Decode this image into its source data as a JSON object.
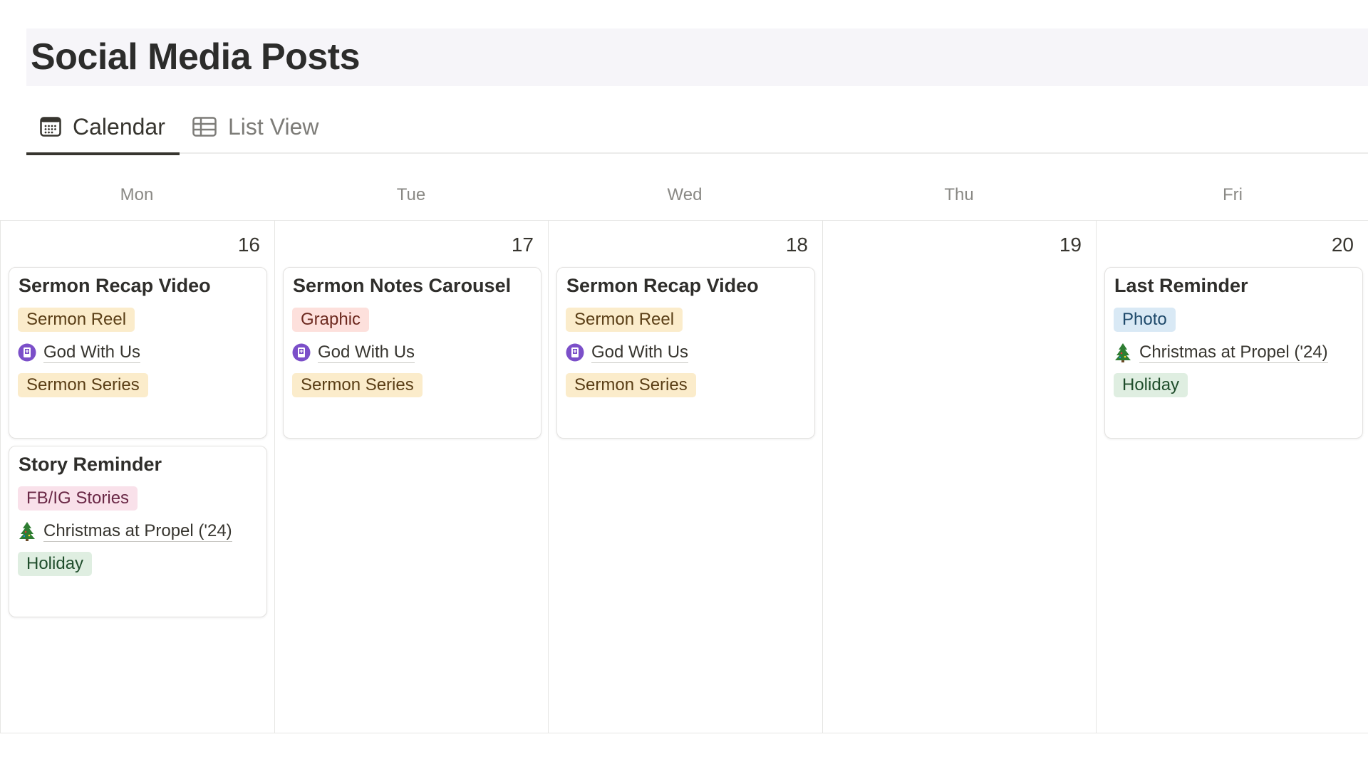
{
  "page": {
    "title": "Social Media Posts"
  },
  "tabs": [
    {
      "label": "Calendar",
      "icon": "calendar-icon",
      "active": true
    },
    {
      "label": "List View",
      "icon": "table-icon",
      "active": false
    }
  ],
  "weekdays": [
    "Mon",
    "Tue",
    "Wed",
    "Thu",
    "Fri"
  ],
  "dates": [
    "16",
    "17",
    "18",
    "19",
    "20"
  ],
  "colors": {
    "yellow_tag": "#fbeccb",
    "red_tag": "#fde0dc",
    "pink_tag": "#f9e1ea",
    "blue_tag": "#d9e9f5",
    "green_tag": "#dfeee1",
    "series_icon": "#7b4fc9"
  },
  "cards": {
    "mon_1": {
      "title": "Sermon Recap Video",
      "type": "Sermon Reel",
      "relation": "God With Us",
      "relation_icon": "book-icon",
      "category": "Sermon Series"
    },
    "mon_2": {
      "title": "Story Reminder",
      "type": "FB/IG Stories",
      "relation": "Christmas at Propel ('24)",
      "relation_icon": "christmas-tree-icon",
      "category": "Holiday"
    },
    "tue_1": {
      "title": "Sermon Notes Carousel",
      "type": "Graphic",
      "relation": "God With Us",
      "relation_icon": "book-icon",
      "category": "Sermon Series"
    },
    "wed_1": {
      "title": "Sermon Recap Video",
      "type": "Sermon Reel",
      "relation": "God With Us",
      "relation_icon": "book-icon",
      "category": "Sermon Series"
    },
    "fri_1": {
      "title": "Last Reminder",
      "type": "Photo",
      "relation": "Christmas at Propel ('24)",
      "relation_icon": "christmas-tree-icon",
      "category": "Holiday"
    }
  }
}
